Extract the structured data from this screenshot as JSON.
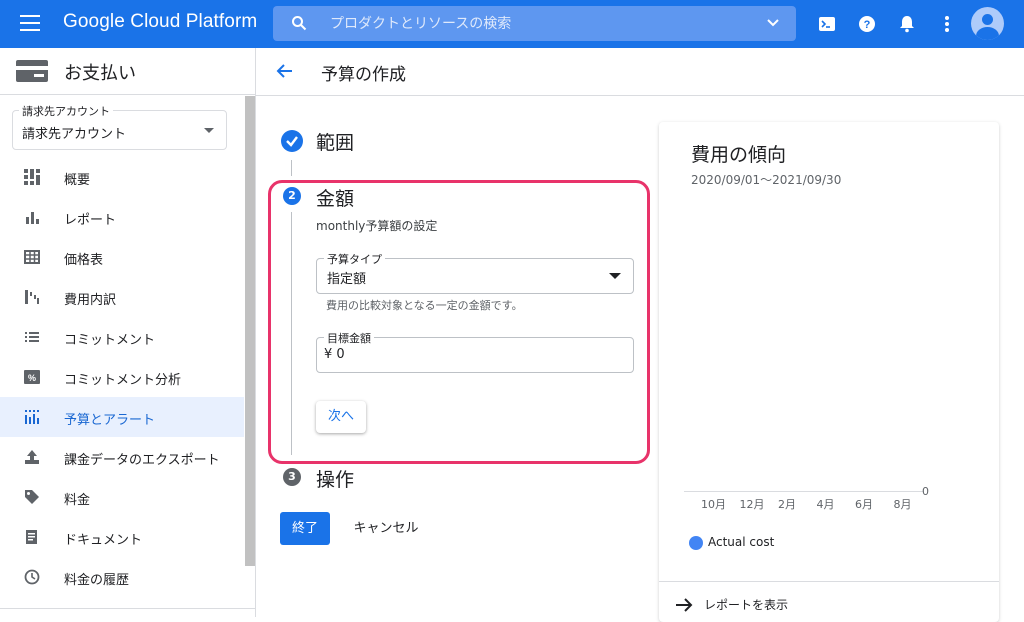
{
  "topbar": {
    "brand": "Google Cloud Platform",
    "search_placeholder": "プロダクトとリソースの検索",
    "icons": [
      "menu-icon",
      "search-icon",
      "chevron-down-icon",
      "terminal-icon",
      "help-icon",
      "bell-icon",
      "more-vert-icon",
      "account-icon"
    ]
  },
  "sidebar": {
    "title": "お支払い",
    "account_legend": "請求先アカウント",
    "account_value": "請求先アカウント",
    "items": [
      {
        "label": "概要",
        "icon": "dashboard-icon"
      },
      {
        "label": "レポート",
        "icon": "bar-chart-icon"
      },
      {
        "label": "価格表",
        "icon": "table-icon"
      },
      {
        "label": "費用内訳",
        "icon": "waterfall-icon"
      },
      {
        "label": "コミットメント",
        "icon": "list-icon"
      },
      {
        "label": "コミットメント分析",
        "icon": "percent-icon"
      },
      {
        "label": "予算とアラート",
        "icon": "budget-icon",
        "active": true
      },
      {
        "label": "課金データのエクスポート",
        "icon": "upload-icon"
      },
      {
        "label": "料金",
        "icon": "tag-icon"
      },
      {
        "label": "ドキュメント",
        "icon": "document-icon"
      },
      {
        "label": "料金の履歴",
        "icon": "clock-icon"
      }
    ]
  },
  "header": {
    "title": "予算の作成"
  },
  "steps": {
    "scope_title": "範囲",
    "amount_number": "2",
    "amount_title": "金額",
    "amount_subtitle": "monthly予算額の設定",
    "budget_type_legend": "予算タイプ",
    "budget_type_value": "指定額",
    "budget_type_hint": "費用の比較対象となる一定の金額です。",
    "target_legend": "目標金額",
    "target_value": "¥ 0",
    "next_label": "次へ",
    "actions_number": "3",
    "actions_title": "操作",
    "finish_label": "終了",
    "cancel_label": "キャンセル"
  },
  "trend": {
    "title": "費用の傾向",
    "range": "2020/09/01〜2021/09/30",
    "zero_label": "0",
    "legend_label": "Actual cost",
    "legend_color": "#4285f4",
    "report_link": "レポートを表示"
  },
  "chart_data": {
    "type": "bar",
    "categories": [
      "10月",
      "12月",
      "2月",
      "4月",
      "6月",
      "8月"
    ],
    "series": [
      {
        "name": "Actual cost",
        "values": [
          0,
          0,
          0,
          0,
          0,
          0
        ]
      }
    ],
    "title": "費用の傾向",
    "subtitle": "2020/09/01〜2021/09/30",
    "ylim": [
      0,
      0
    ],
    "legend": "bottom-left"
  },
  "colors": {
    "primary": "#1a73e8",
    "highlight": "#e8336a",
    "active_bg": "#e8f0fe"
  }
}
